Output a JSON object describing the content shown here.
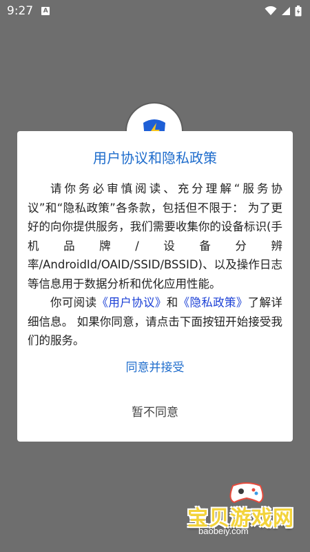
{
  "status_bar": {
    "time": "9:27",
    "notification_glyph": "A",
    "icons": [
      "wifi-icon",
      "signal-icon",
      "battery-icon"
    ]
  },
  "dialog": {
    "title": "用户协议和隐私政策",
    "paragraph1": "请你务必审慎阅读、充分理解“服务协议”和“隐私政策”各条款，包括但不限于： 为了更好的向你提供服务，我们需要收集你的设备标识(手机品牌/设备分辨率/AndroidId/OAID/SSID/BSSID)、以及操作日志等信息用于数据分析和优化应用性能。",
    "paragraph2": {
      "prefix": "你可阅读",
      "user_agreement_link": "《用户协议》",
      "and": "和",
      "privacy_policy_link": "《隐私政策》",
      "suffix": "了解详细信息。 如果你同意，请点击下面按钮开始接受我们的服务。"
    },
    "agree_button": "同意并接受",
    "disagree_button": "暂不同意"
  },
  "watermark": {
    "text": "宝贝游戏网",
    "url": "baobeiy.com"
  },
  "colors": {
    "accent": "#1e6ccc",
    "link": "#1a3fd6",
    "overlay": "#6e6e6e"
  }
}
